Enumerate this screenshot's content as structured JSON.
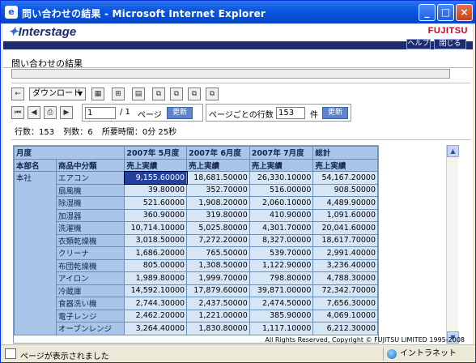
{
  "window": {
    "title": "問い合わせの結果 - Microsoft Internet Explorer"
  },
  "brand": {
    "logo": "Interstage",
    "vendor": "FUJITSU"
  },
  "nav": {
    "help": "ヘルプ",
    "close": "閉じる"
  },
  "page": {
    "title": "問い合わせの結果"
  },
  "toolbar": {
    "download_label": "ダウンロード"
  },
  "pager": {
    "current_page": "1",
    "total_pages": "/ 1",
    "page_unit": "ページ",
    "update": "更新"
  },
  "rows_per_page": {
    "label": "ページごとの行数",
    "value": "153",
    "unit": "件",
    "update": "更新"
  },
  "stats": {
    "rows": "行数：153",
    "cols": "列数：6",
    "elapsed": "所要時間：0分 25秒"
  },
  "grid": {
    "h1": {
      "c1": "月度",
      "c2": "2007年 5月度",
      "c3": "2007年 6月度",
      "c4": "2007年 7月度",
      "c5": "総計"
    },
    "h2": {
      "c1": "本部名",
      "c2": "商品中分類",
      "c3": "売上実績",
      "c4": "売上実績",
      "c5": "売上実績",
      "c6": "売上実績"
    },
    "dept": "本社",
    "rows": [
      {
        "name": "エアコン",
        "m5": "9,155.60000",
        "m6": "18,681.50000",
        "m7": "26,330.10000",
        "total": "54,167.20000"
      },
      {
        "name": "扇風機",
        "m5": "39.80000",
        "m6": "352.70000",
        "m7": "516.00000",
        "total": "908.50000"
      },
      {
        "name": "除湿機",
        "m5": "521.60000",
        "m6": "1,908.20000",
        "m7": "2,060.10000",
        "total": "4,489.90000"
      },
      {
        "name": "加湿器",
        "m5": "360.90000",
        "m6": "319.80000",
        "m7": "410.90000",
        "total": "1,091.60000"
      },
      {
        "name": "洗濯機",
        "m5": "10,714.10000",
        "m6": "5,025.80000",
        "m7": "4,301.70000",
        "total": "20,041.60000"
      },
      {
        "name": "衣類乾燥機",
        "m5": "3,018.50000",
        "m6": "7,272.20000",
        "m7": "8,327.00000",
        "total": "18,617.70000"
      },
      {
        "name": "クリーナ",
        "m5": "1,686.20000",
        "m6": "765.50000",
        "m7": "539.70000",
        "total": "2,991.40000"
      },
      {
        "name": "布団乾燥機",
        "m5": "805.00000",
        "m6": "1,308.50000",
        "m7": "1,122.90000",
        "total": "3,236.40000"
      },
      {
        "name": "アイロン",
        "m5": "1,989.80000",
        "m6": "1,999.70000",
        "m7": "798.80000",
        "total": "4,788.30000"
      },
      {
        "name": "冷蔵庫",
        "m5": "14,592.10000",
        "m6": "17,879.60000",
        "m7": "39,871.00000",
        "total": "72,342.70000"
      },
      {
        "name": "食器洗い機",
        "m5": "2,744.30000",
        "m6": "2,437.50000",
        "m7": "2,474.50000",
        "total": "7,656.30000"
      },
      {
        "name": "電子レンジ",
        "m5": "2,462.20000",
        "m6": "1,221.00000",
        "m7": "385.90000",
        "total": "4,069.10000"
      },
      {
        "name": "オーブンレンジ",
        "m5": "3,264.40000",
        "m6": "1,830.80000",
        "m7": "1,117.10000",
        "total": "6,212.30000"
      }
    ]
  },
  "footer": {
    "copyright": "All Rights Reserved, Copyright © FUJITSU LIMITED 1995-2008"
  },
  "status": {
    "message": "ページが表示されました",
    "zone": "イントラネット"
  }
}
